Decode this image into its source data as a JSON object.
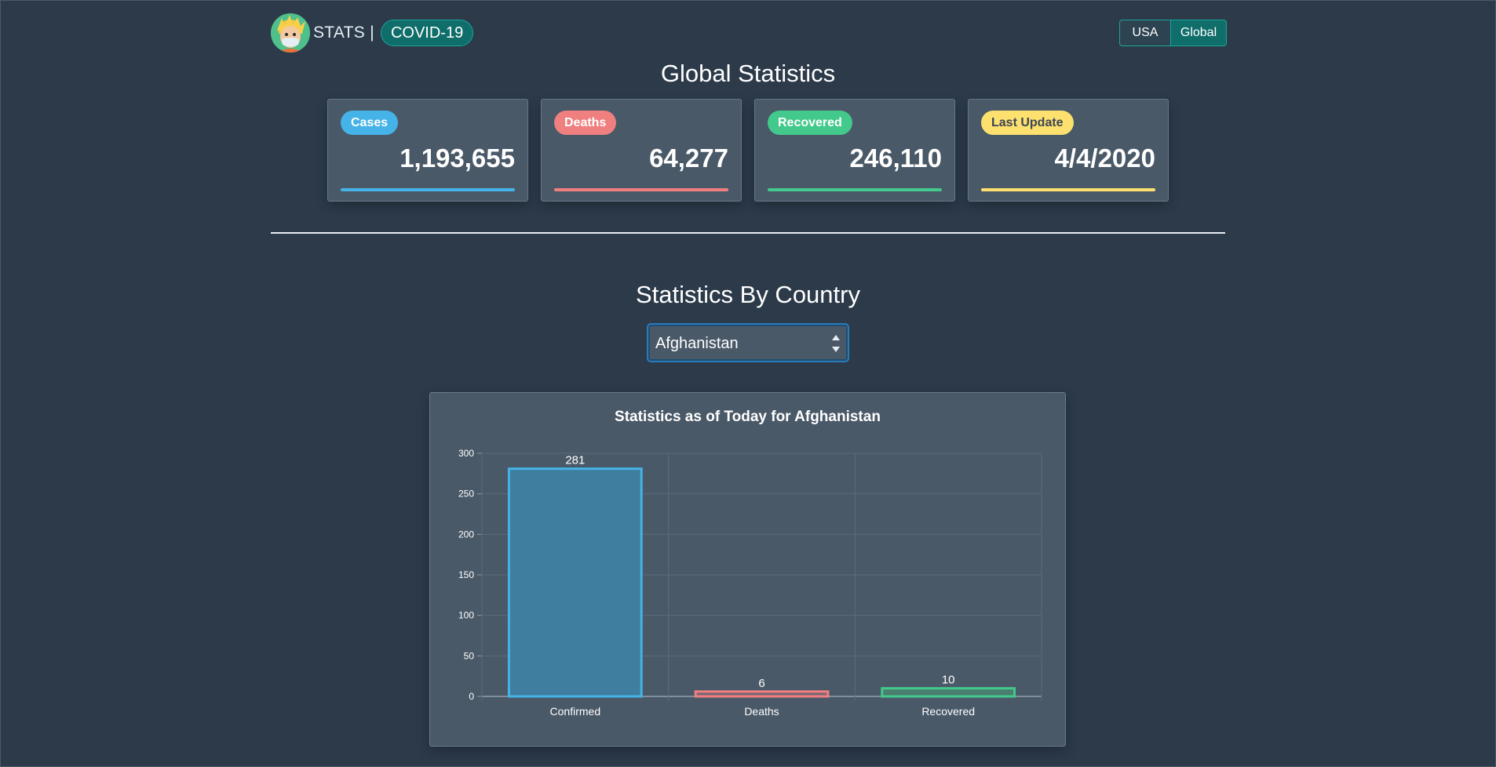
{
  "header": {
    "brand_text": "STATS |",
    "brand_pill": "COVID-19",
    "toggle": {
      "usa_label": "USA",
      "global_label": "Global"
    }
  },
  "global": {
    "title": "Global Statistics",
    "cards": [
      {
        "badge": "Cases",
        "value": "1,193,655",
        "color": "#45b3e7"
      },
      {
        "badge": "Deaths",
        "value": "64,277",
        "color": "#f07f80"
      },
      {
        "badge": "Recovered",
        "value": "246,110",
        "color": "#43c98c"
      },
      {
        "badge": "Last Update",
        "value": "4/4/2020",
        "color": "#fde06e"
      }
    ]
  },
  "country": {
    "title": "Statistics By Country",
    "selected": "Afghanistan"
  },
  "chart_data": {
    "type": "bar",
    "title": "Statistics as of Today for Afghanistan",
    "categories": [
      "Confirmed",
      "Deaths",
      "Recovered"
    ],
    "values": [
      281,
      6,
      10
    ],
    "colors": [
      "#45b3e7",
      "#f07f80",
      "#43c98c"
    ],
    "fill_colors": [
      "#3f7e9f",
      "#7a6670",
      "#4a7e6e"
    ],
    "ylim": [
      0,
      300
    ],
    "yticks": [
      0,
      50,
      100,
      150,
      200,
      250,
      300
    ],
    "grid": true
  }
}
